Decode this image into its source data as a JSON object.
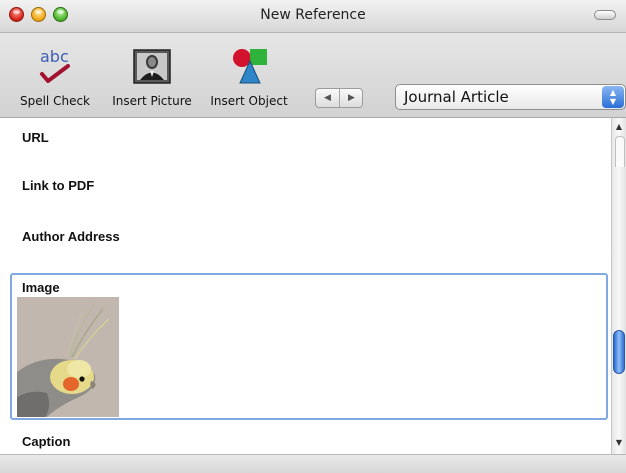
{
  "window": {
    "title": "New Reference"
  },
  "toolbar": {
    "spell_check": {
      "label": "Spell Check",
      "icon": "spell-check-icon",
      "icon_text": "abc"
    },
    "insert_picture": {
      "label": "Insert Picture",
      "icon": "portrait-photo-icon"
    },
    "insert_object": {
      "label": "Insert Object",
      "icon": "shapes-icon"
    },
    "nav": {
      "prev_icon": "◀",
      "next_icon": "▶"
    },
    "reference_type": {
      "value": "Journal Article",
      "stepper_up": "▲",
      "stepper_down": "▼"
    }
  },
  "fields": [
    {
      "label": "URL"
    },
    {
      "label": "Link to PDF"
    },
    {
      "label": "Author Address"
    },
    {
      "label": "Image",
      "value_icon": "cockatiel-image"
    },
    {
      "label": "Caption"
    }
  ],
  "scrollbar": {
    "up": "▲",
    "down": "▼"
  },
  "colors": {
    "focus_ring": "#7fa9e0",
    "accent": "#2a6fd8"
  }
}
